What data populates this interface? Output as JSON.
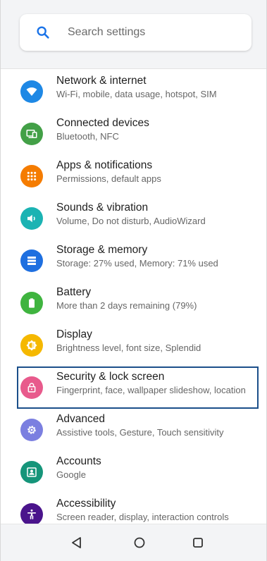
{
  "search": {
    "placeholder": "Search settings"
  },
  "items": [
    {
      "title": "Network & internet",
      "subtitle": "Wi-Fi, mobile, data usage, hotspot, SIM",
      "color": "#1e88e5",
      "icon": "wifi-icon"
    },
    {
      "title": "Connected devices",
      "subtitle": "Bluetooth, NFC",
      "color": "#43a047",
      "icon": "devices-icon"
    },
    {
      "title": "Apps & notifications",
      "subtitle": "Permissions, default apps",
      "color": "#f57c00",
      "icon": "apps-grid-icon"
    },
    {
      "title": "Sounds & vibration",
      "subtitle": "Volume, Do not disturb, AudioWizard",
      "color": "#1bb3b3",
      "icon": "volume-icon"
    },
    {
      "title": "Storage & memory",
      "subtitle": "Storage: 27% used, Memory: 71% used",
      "color": "#1e6fe0",
      "icon": "storage-icon"
    },
    {
      "title": "Battery",
      "subtitle": "More than 2 days remaining (79%)",
      "color": "#3fb43f",
      "icon": "battery-icon"
    },
    {
      "title": "Display",
      "subtitle": "Brightness level, font size, Splendid",
      "color": "#f5b800",
      "icon": "brightness-icon"
    },
    {
      "title": "Security & lock screen",
      "subtitle": "Fingerprint, face, wallpaper slideshow, location",
      "color": "#e85a8c",
      "icon": "lock-icon"
    },
    {
      "title": "Advanced",
      "subtitle": "Assistive tools, Gesture, Touch sensitivity",
      "color": "#7b7fe0",
      "icon": "gear-icon"
    },
    {
      "title": "Accounts",
      "subtitle": "Google",
      "color": "#15957a",
      "icon": "account-icon"
    },
    {
      "title": "Accessibility",
      "subtitle": "Screen reader, display, interaction controls",
      "color": "#4a148c",
      "icon": "accessibility-icon"
    }
  ],
  "navigation": {
    "back": "back-icon",
    "home": "home-icon",
    "recents": "recents-icon"
  }
}
